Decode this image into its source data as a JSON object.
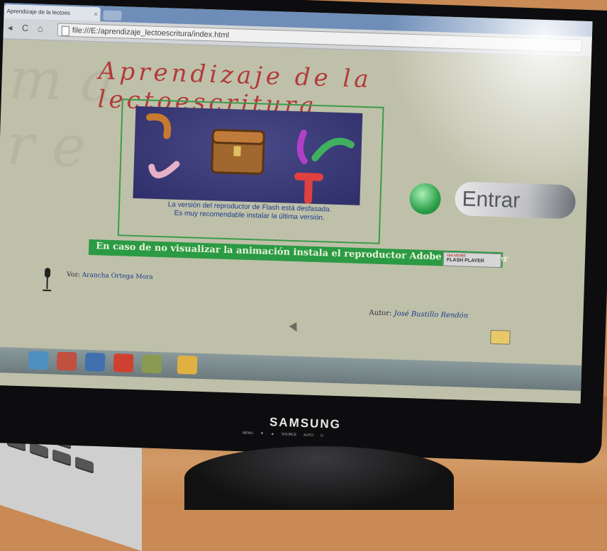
{
  "browser": {
    "tab_title": "Aprendizaje de la lectoes",
    "tab_close": "×",
    "url": "file:///E:/aprendizaje_lectoescritura/index.html",
    "nav_back": "◂",
    "nav_reload": "C",
    "nav_home": "⌂"
  },
  "page": {
    "title": "Aprendizaje de la lectoescritura",
    "flash_message_line1": "La versión del reproductor de Flash está desfasada.",
    "flash_message_line2": "Es muy recomendable instalar la última versión.",
    "enter_label": "Entrar",
    "install_bar_text": "En caso de no visualizar la animación instala el reproductor Adobe Flash Player",
    "flash_badge_line1": "Get ADOBE",
    "flash_badge_line2": "FLASH PLAYER",
    "voice_prefix": "Voz:",
    "voice_name": "Arancha Ortega Mora",
    "author_prefix": "Autor:",
    "author_name": "José Bustillo Rendón"
  },
  "monitor": {
    "brand": "SAMSUNG",
    "controls": [
      "MENU",
      "▼",
      "▲",
      "SOURCE",
      "AUTO",
      "⏻"
    ]
  },
  "icons": {
    "enter": "enter-icon",
    "mic": "microphone-icon",
    "email": "email-icon"
  },
  "colors": {
    "title_red": "#b23a3a",
    "install_green": "#2b9a44",
    "screen_bg": "#bfc0a9"
  }
}
